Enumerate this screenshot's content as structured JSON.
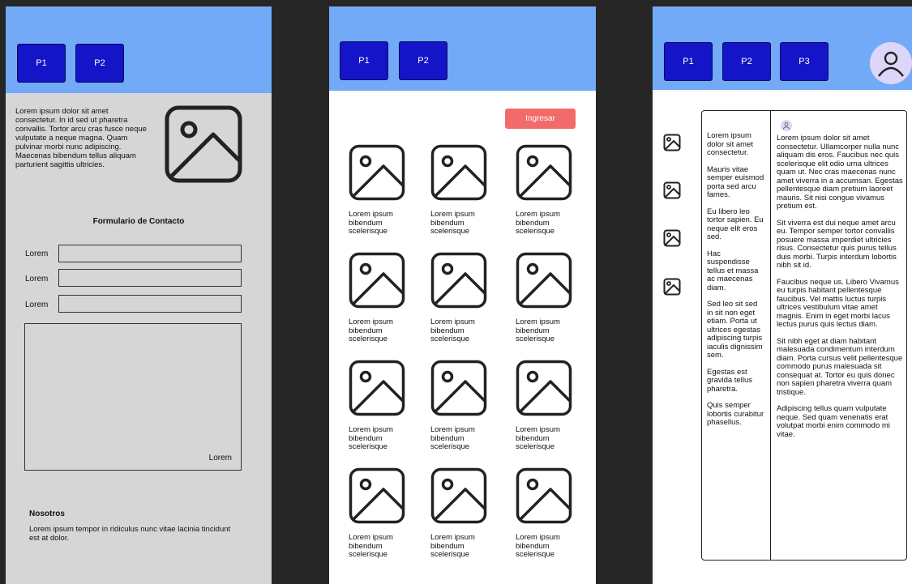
{
  "screen1": {
    "nav": [
      "P1",
      "P2"
    ],
    "intro": "Lorem ipsum dolor sit amet consectetur. In id sed ut pharetra convallis. Tortor arcu cras fusce neque vulputate a neque magna. Quam pulvinar morbi nunc adipiscing. Maecenas bibendum tellus aliquam parturient sagittis ultricies.",
    "image_icon": "image-icon",
    "form": {
      "title": "Formulario de Contacto",
      "fields": [
        "Lorem",
        "Lorem",
        "Lorem"
      ],
      "message_label": "Lorem"
    },
    "about": {
      "title": "Nosotros",
      "text": "Lorem ipsum tempor in ridiculus nunc vitae lacinia tincidunt est at dolor."
    }
  },
  "screen2": {
    "nav": [
      "P1",
      "P2"
    ],
    "login_label": "Ingresar",
    "card_caption": "Lorem ipsum bibendum scelerisque",
    "cards": 12
  },
  "screen3": {
    "nav": [
      "P1",
      "P2",
      "P3"
    ],
    "avatar_icon": "user-icon",
    "left_column": [
      "Lorem ipsum dolor sit amet consectetur.",
      "Mauris vitae semper euismod porta sed arcu fames.",
      "Eu libero leo tortor sapien. Eu neque elit eros sed.",
      "Hac suspendisse tellus et massa ac maecenas diam.",
      "Sed leo sit sed in sit non eget etiam. Porta ut ultrices egestas adipiscing turpis iaculis dignissim sem.",
      "Egestas est gravida tellus pharetra.",
      "Quis semper lobortis curabitur phasellus."
    ],
    "right_column": [
      "Lorem ipsum dolor sit amet consectetur. Ullamcorper nulla nunc aliquam dis eros. Faucibus nec quis scelerisque elit odio urna ultrices quam ut. Nec cras maecenas nunc amet viverra in a accumsan. Egestas pellentesque diam pretium laoreet mauris. Sit nisi congue vivamus pretium est.",
      "Sit viverra est dui neque amet arcu eu. Tempor semper tortor convallis posuere massa imperdiet ultricies risus. Consectetur quis purus tellus duis morbi. Turpis interdum lobortis nibh sit id.",
      "Faucibus neque us. Libero Vivamus eu turpis habitant pellentesque faucibus. Vel mattis luctus turpis ultrices vestibulum vitae amet magnis. Enim in eget morbi lacus lectus purus quis lectus diam.",
      "Sit nibh eget at diam habitant malesuada condimentum interdum diam. Porta cursus velit pellentesque commodo purus malesuada sit consequat at. Tortor eu quis donec non sapien pharetra viverra quam tristique.",
      "Adipiscing tellus quam vulputate neque. Sed quam venenatis erat volutpat morbi enim commodo mi vitae."
    ]
  },
  "colors": {
    "header": "#72aaf8",
    "nav_button": "#1414c8",
    "login_button": "#f26a6a",
    "avatar_bg": "#ddd6f8",
    "gutter": "#262626"
  }
}
